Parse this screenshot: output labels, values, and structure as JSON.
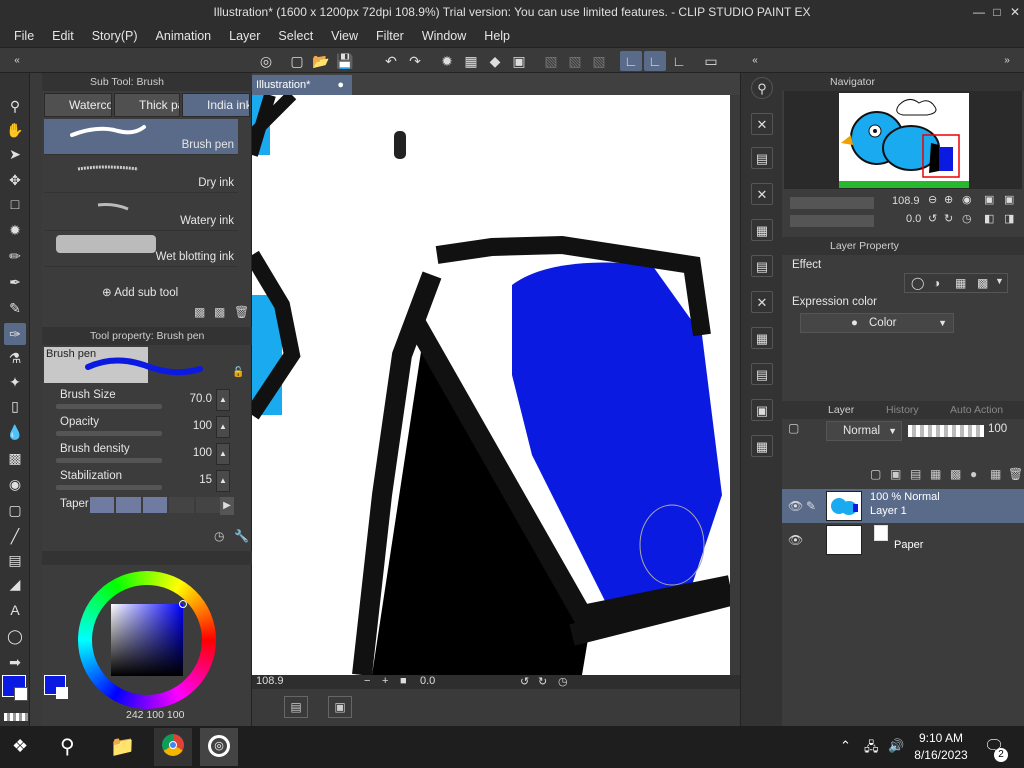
{
  "window": {
    "title": "Illustration* (1600 x 1200px 72dpi 108.9%)  Trial version: You can use limited features. - CLIP STUDIO PAINT EX"
  },
  "menu": [
    "File",
    "Edit",
    "Story(P)",
    "Animation",
    "Layer",
    "Select",
    "View",
    "Filter",
    "Window",
    "Help"
  ],
  "subtool": {
    "header": "Sub Tool: Brush",
    "tabs": [
      {
        "label": "Waterco"
      },
      {
        "label": "Thick pa"
      },
      {
        "label": "India ink"
      }
    ],
    "brushes": [
      {
        "label": "Brush pen"
      },
      {
        "label": "Dry ink"
      },
      {
        "label": "Watery ink"
      },
      {
        "label": "Wet blotting ink"
      }
    ],
    "add_label": "Add sub tool"
  },
  "toolprop": {
    "header": "Tool property: Brush pen",
    "preview_label": "Brush pen",
    "props": [
      {
        "label": "Brush Size",
        "value": "70.0"
      },
      {
        "label": "Opacity",
        "value": "100"
      },
      {
        "label": "Brush density",
        "value": "100"
      },
      {
        "label": "Stabilization",
        "value": "15"
      }
    ],
    "taper_label": "Taper"
  },
  "color": {
    "readout": "242",
    "readout2": "100",
    "readout3": "100",
    "main_color": "#0a1ae0",
    "sub_color": "#ffffff"
  },
  "canvas": {
    "tab_label": "Illustration*",
    "zoom": "108.9",
    "rotation": "0.0"
  },
  "navigator": {
    "header": "Navigator",
    "zoom": "108.9",
    "rotation": "0.0"
  },
  "layer_property": {
    "header": "Layer Property",
    "effect_label": "Effect",
    "expr_label": "Expression color",
    "expr_value": "Color"
  },
  "layers": {
    "tabs": [
      {
        "label": "Layer"
      },
      {
        "label": "History"
      },
      {
        "label": "Auto Action"
      }
    ],
    "blend_mode": "Normal",
    "opacity": "100",
    "items": [
      {
        "line1": "100 % Normal",
        "line2": "Layer 1"
      },
      {
        "line1": "",
        "line2": "Paper"
      }
    ]
  },
  "taskbar": {
    "time": "9:10 AM",
    "date": "8/16/2023",
    "notif_count": "2"
  }
}
